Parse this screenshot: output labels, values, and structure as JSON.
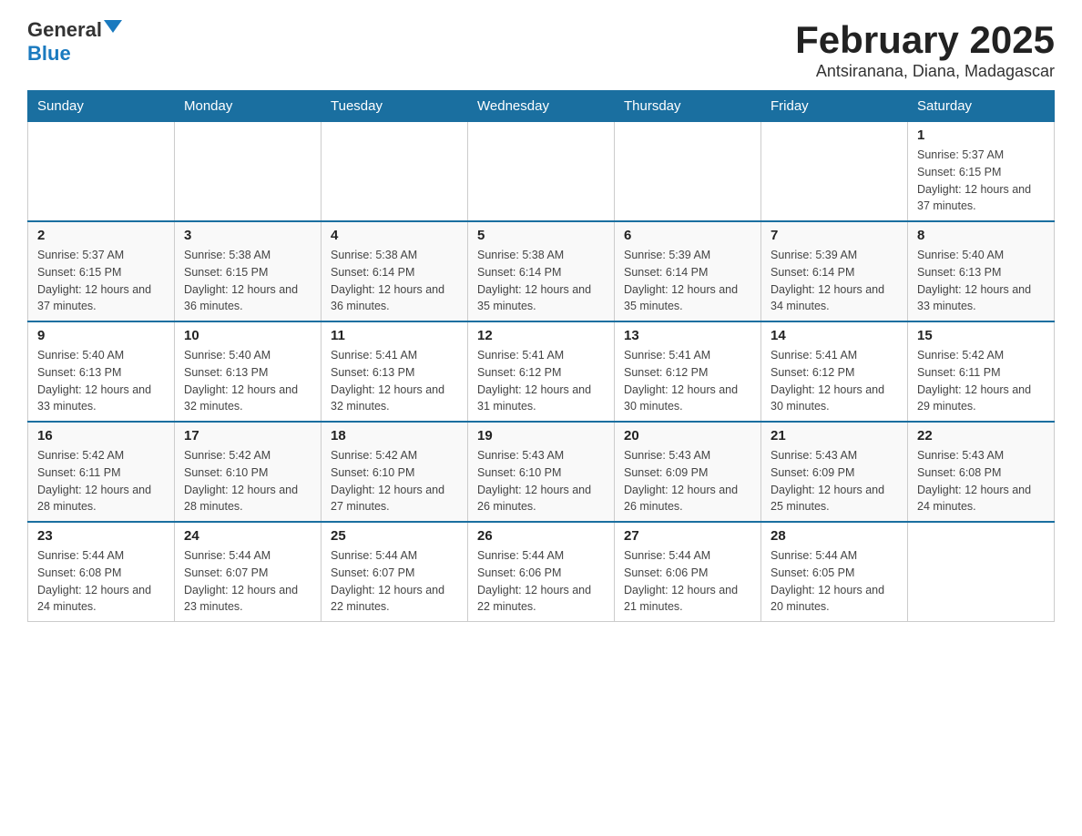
{
  "header": {
    "logo_general": "General",
    "logo_blue": "Blue",
    "month_title": "February 2025",
    "location": "Antsiranana, Diana, Madagascar"
  },
  "days_of_week": [
    "Sunday",
    "Monday",
    "Tuesday",
    "Wednesday",
    "Thursday",
    "Friday",
    "Saturday"
  ],
  "weeks": [
    {
      "days": [
        {
          "number": "",
          "info": ""
        },
        {
          "number": "",
          "info": ""
        },
        {
          "number": "",
          "info": ""
        },
        {
          "number": "",
          "info": ""
        },
        {
          "number": "",
          "info": ""
        },
        {
          "number": "",
          "info": ""
        },
        {
          "number": "1",
          "info": "Sunrise: 5:37 AM\nSunset: 6:15 PM\nDaylight: 12 hours and 37 minutes."
        }
      ]
    },
    {
      "days": [
        {
          "number": "2",
          "info": "Sunrise: 5:37 AM\nSunset: 6:15 PM\nDaylight: 12 hours and 37 minutes."
        },
        {
          "number": "3",
          "info": "Sunrise: 5:38 AM\nSunset: 6:15 PM\nDaylight: 12 hours and 36 minutes."
        },
        {
          "number": "4",
          "info": "Sunrise: 5:38 AM\nSunset: 6:14 PM\nDaylight: 12 hours and 36 minutes."
        },
        {
          "number": "5",
          "info": "Sunrise: 5:38 AM\nSunset: 6:14 PM\nDaylight: 12 hours and 35 minutes."
        },
        {
          "number": "6",
          "info": "Sunrise: 5:39 AM\nSunset: 6:14 PM\nDaylight: 12 hours and 35 minutes."
        },
        {
          "number": "7",
          "info": "Sunrise: 5:39 AM\nSunset: 6:14 PM\nDaylight: 12 hours and 34 minutes."
        },
        {
          "number": "8",
          "info": "Sunrise: 5:40 AM\nSunset: 6:13 PM\nDaylight: 12 hours and 33 minutes."
        }
      ]
    },
    {
      "days": [
        {
          "number": "9",
          "info": "Sunrise: 5:40 AM\nSunset: 6:13 PM\nDaylight: 12 hours and 33 minutes."
        },
        {
          "number": "10",
          "info": "Sunrise: 5:40 AM\nSunset: 6:13 PM\nDaylight: 12 hours and 32 minutes."
        },
        {
          "number": "11",
          "info": "Sunrise: 5:41 AM\nSunset: 6:13 PM\nDaylight: 12 hours and 32 minutes."
        },
        {
          "number": "12",
          "info": "Sunrise: 5:41 AM\nSunset: 6:12 PM\nDaylight: 12 hours and 31 minutes."
        },
        {
          "number": "13",
          "info": "Sunrise: 5:41 AM\nSunset: 6:12 PM\nDaylight: 12 hours and 30 minutes."
        },
        {
          "number": "14",
          "info": "Sunrise: 5:41 AM\nSunset: 6:12 PM\nDaylight: 12 hours and 30 minutes."
        },
        {
          "number": "15",
          "info": "Sunrise: 5:42 AM\nSunset: 6:11 PM\nDaylight: 12 hours and 29 minutes."
        }
      ]
    },
    {
      "days": [
        {
          "number": "16",
          "info": "Sunrise: 5:42 AM\nSunset: 6:11 PM\nDaylight: 12 hours and 28 minutes."
        },
        {
          "number": "17",
          "info": "Sunrise: 5:42 AM\nSunset: 6:10 PM\nDaylight: 12 hours and 28 minutes."
        },
        {
          "number": "18",
          "info": "Sunrise: 5:42 AM\nSunset: 6:10 PM\nDaylight: 12 hours and 27 minutes."
        },
        {
          "number": "19",
          "info": "Sunrise: 5:43 AM\nSunset: 6:10 PM\nDaylight: 12 hours and 26 minutes."
        },
        {
          "number": "20",
          "info": "Sunrise: 5:43 AM\nSunset: 6:09 PM\nDaylight: 12 hours and 26 minutes."
        },
        {
          "number": "21",
          "info": "Sunrise: 5:43 AM\nSunset: 6:09 PM\nDaylight: 12 hours and 25 minutes."
        },
        {
          "number": "22",
          "info": "Sunrise: 5:43 AM\nSunset: 6:08 PM\nDaylight: 12 hours and 24 minutes."
        }
      ]
    },
    {
      "days": [
        {
          "number": "23",
          "info": "Sunrise: 5:44 AM\nSunset: 6:08 PM\nDaylight: 12 hours and 24 minutes."
        },
        {
          "number": "24",
          "info": "Sunrise: 5:44 AM\nSunset: 6:07 PM\nDaylight: 12 hours and 23 minutes."
        },
        {
          "number": "25",
          "info": "Sunrise: 5:44 AM\nSunset: 6:07 PM\nDaylight: 12 hours and 22 minutes."
        },
        {
          "number": "26",
          "info": "Sunrise: 5:44 AM\nSunset: 6:06 PM\nDaylight: 12 hours and 22 minutes."
        },
        {
          "number": "27",
          "info": "Sunrise: 5:44 AM\nSunset: 6:06 PM\nDaylight: 12 hours and 21 minutes."
        },
        {
          "number": "28",
          "info": "Sunrise: 5:44 AM\nSunset: 6:05 PM\nDaylight: 12 hours and 20 minutes."
        },
        {
          "number": "",
          "info": ""
        }
      ]
    }
  ]
}
